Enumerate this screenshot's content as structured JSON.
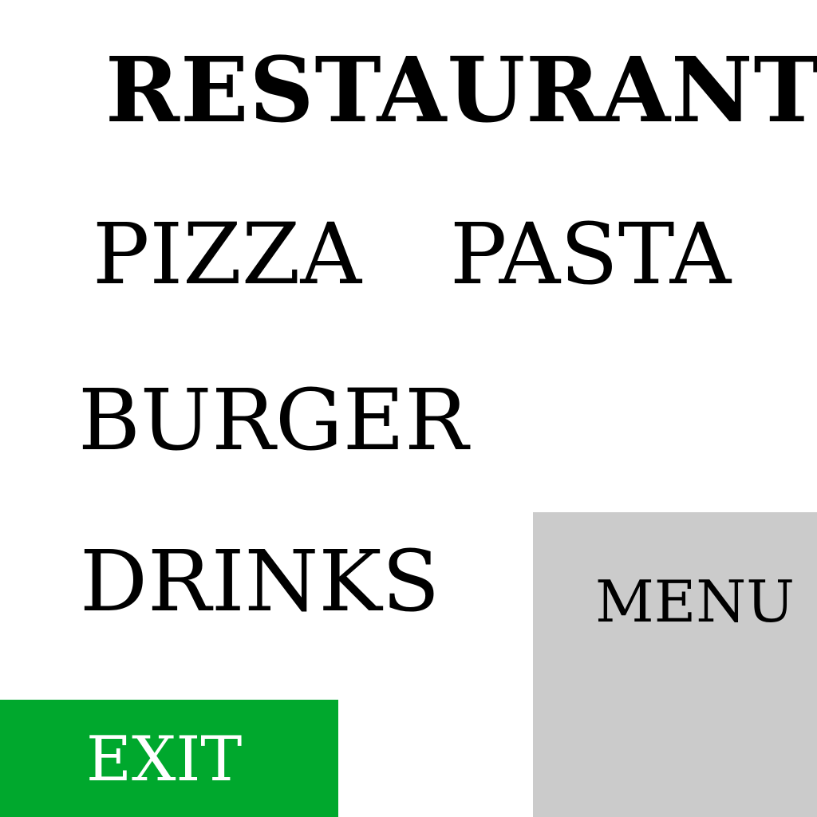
{
  "header": {
    "title": "RESTAURANT"
  },
  "categories": [
    {
      "label": "PIZZA"
    },
    {
      "label": "PASTA"
    },
    {
      "label": "BURGER"
    },
    {
      "label": "DRINKS"
    }
  ],
  "buttons": {
    "menu_label": "MENU",
    "exit_label": "EXIT"
  },
  "colors": {
    "background": "#ffffff",
    "menu_button_bg": "#cbcbcb",
    "exit_button_bg": "#00a82d",
    "exit_text": "#ffffff",
    "text": "#000000"
  }
}
